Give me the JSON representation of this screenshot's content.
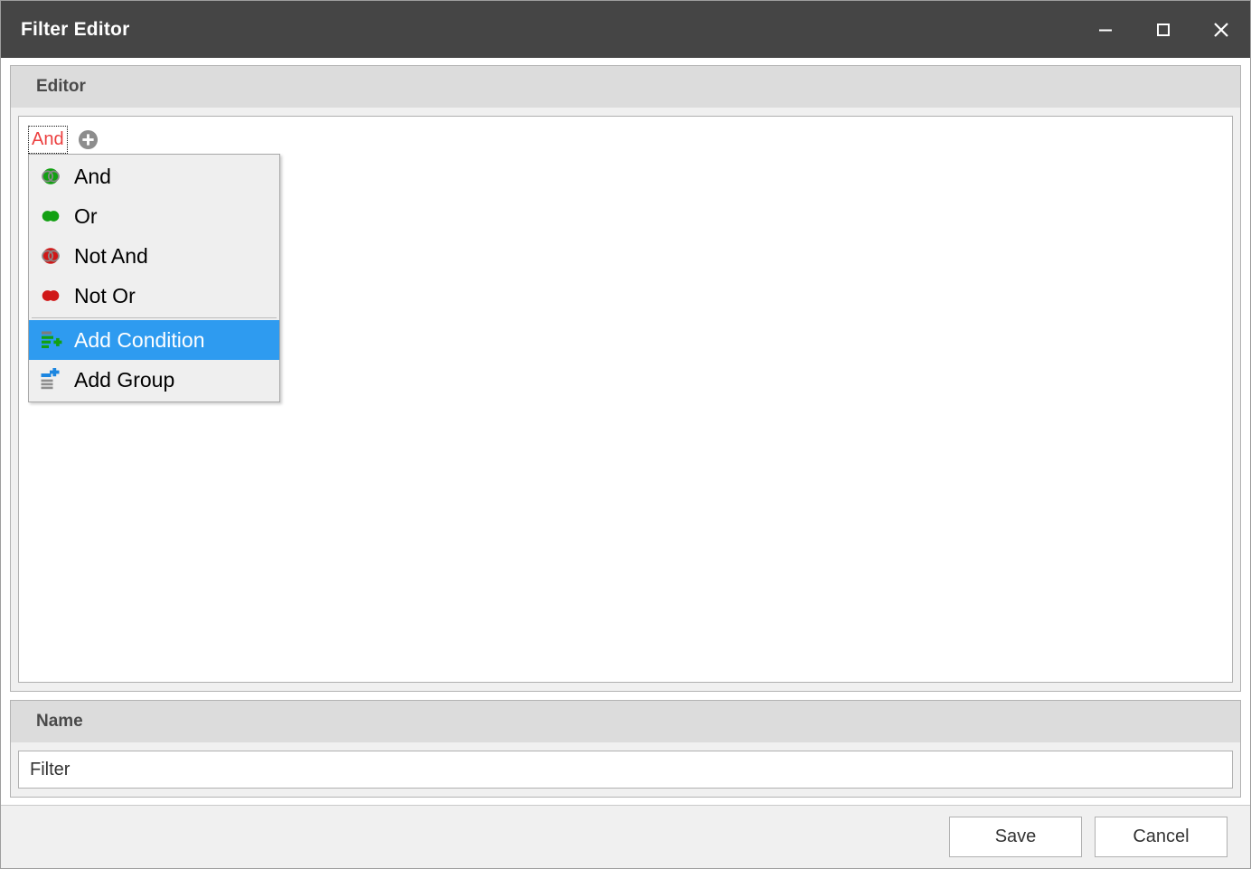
{
  "window": {
    "title": "Filter Editor",
    "controls": [
      {
        "name": "minimize-button",
        "label": "Minimize"
      },
      {
        "name": "maximize-button",
        "label": "Maximize"
      },
      {
        "name": "close-button",
        "label": "Close"
      }
    ]
  },
  "editor_section": {
    "header": "Editor",
    "root_operator": "And",
    "add_button_label": "+"
  },
  "menu": {
    "items": [
      {
        "label": "And",
        "icon": "venn-and-icon",
        "selected": false
      },
      {
        "label": "Or",
        "icon": "venn-or-icon",
        "selected": false
      },
      {
        "label": "Not And",
        "icon": "venn-not-and-icon",
        "selected": false
      },
      {
        "label": "Not Or",
        "icon": "venn-not-or-icon",
        "selected": false
      },
      {
        "label": "Add Condition",
        "icon": "add-condition-icon",
        "selected": true
      },
      {
        "label": "Add Group",
        "icon": "add-group-icon",
        "selected": false
      }
    ]
  },
  "name_section": {
    "header": "Name",
    "value": "Filter",
    "placeholder": "Filter"
  },
  "footer": {
    "save_label": "Save",
    "cancel_label": "Cancel"
  },
  "colors": {
    "titlebar": "#454545",
    "operator_text": "#ec3f3f",
    "menu_highlight": "#2e9bf0",
    "green": "#12a012",
    "red": "#d01818",
    "group_header": "#dcdcdc"
  }
}
